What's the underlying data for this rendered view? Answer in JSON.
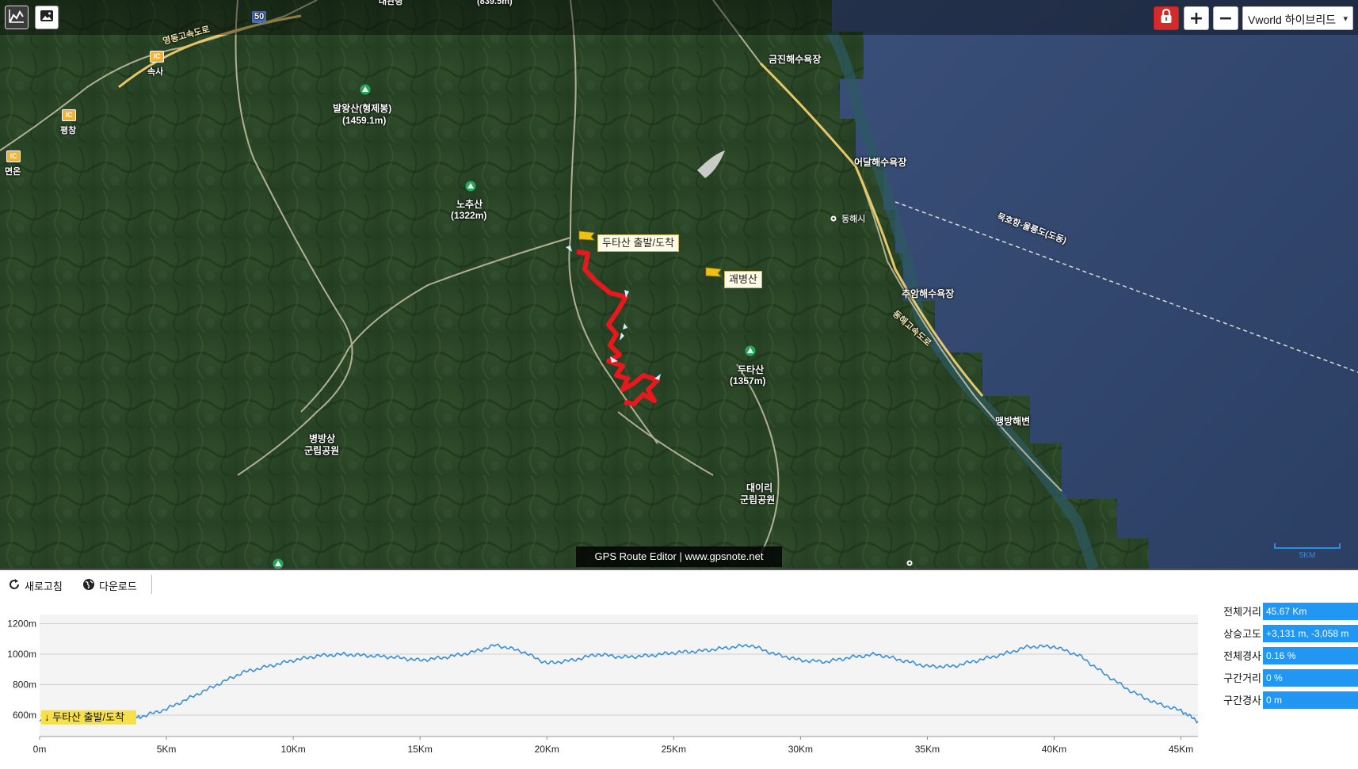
{
  "toolbar": {
    "chart_icon": "chart-icon",
    "image_icon": "image-icon",
    "lock_icon": "lock-icon",
    "zoom_in_label": "+",
    "zoom_out_label": "−",
    "layer_select": "Vworld 하이브리드"
  },
  "map": {
    "labels": {
      "top_place": "대관령",
      "top_peak": "(839.5m)",
      "sokssa": "속사",
      "pyeongchang": "평창",
      "myeonon": "면온",
      "balwangsan_name": "발왕산(형제봉)",
      "balwangsan_height": "(1459.1m)",
      "nochusan_name": "노추산",
      "nochusan_height": "(1322m)",
      "geumjin": "금진해수욕장",
      "eodal": "어달해수욕장",
      "donghae": "동해시",
      "chuam": "추암해수욕장",
      "dutasan_name": "두타산",
      "dutasan_height": "(1357m)",
      "maengbang": "맹방해변",
      "byeongbangsan_1": "병방상",
      "byeongbangsan_2": "군립공원",
      "daeiri_1": "대이리",
      "daeiri_2": "군립공원",
      "ferry": "묵호항-울릉도(도동)",
      "highway": "동해고속도로",
      "route50": "50",
      "ic": "IC",
      "yeongdong": "영동고속도로"
    },
    "flags": {
      "start": "두타산 출발/도착",
      "waypoint": "괘병산"
    },
    "credit": "GPS Route Editor | www.gpsnote.net",
    "scale_label": "5KM",
    "colors": {
      "route": "#e8181c",
      "sea": "#2a4060",
      "land": "#2c4a28"
    }
  },
  "bottom_toolbar": {
    "refresh_label": "새로고침",
    "download_label": "다운로드"
  },
  "chart_data": {
    "type": "area",
    "series": [
      {
        "x": [
          0,
          1,
          2,
          3,
          3.5,
          4,
          5,
          6,
          7,
          8,
          9,
          10,
          11,
          12,
          13,
          14,
          15,
          16,
          17,
          18,
          19,
          20,
          21,
          22,
          23,
          24,
          25,
          26,
          27,
          28,
          29,
          30,
          31,
          32,
          33,
          34,
          35,
          36,
          37,
          38,
          39,
          40,
          41,
          42,
          43,
          44,
          45,
          45.67
        ],
        "values": [
          560,
          555,
          565,
          570,
          575,
          590,
          640,
          720,
          800,
          880,
          920,
          960,
          990,
          1000,
          990,
          980,
          960,
          980,
          1010,
          1060,
          1020,
          940,
          960,
          1000,
          980,
          990,
          1010,
          1020,
          1040,
          1060,
          1000,
          960,
          950,
          980,
          1000,
          960,
          920,
          920,
          960,
          1000,
          1050,
          1050,
          990,
          870,
          760,
          680,
          630,
          560
        ]
      }
    ],
    "xlabel_ticks": [
      "0m",
      "5Km",
      "10Km",
      "15Km",
      "20Km",
      "25Km",
      "30Km",
      "35Km",
      "40Km",
      "45Km"
    ],
    "ylabel_ticks": [
      "600m",
      "800m",
      "1000m",
      "1200m"
    ],
    "xlim": [
      0,
      45.67
    ],
    "ylim": [
      460,
      1260
    ],
    "annotation": "↓ 두타산 출발/도착",
    "color": "#3a8fd9",
    "grid": true
  },
  "stats": [
    {
      "label": "전체거리",
      "value": "45.67 Km"
    },
    {
      "label": "상승고도",
      "value": "+3,131 m, -3,058 m"
    },
    {
      "label": "전체경사",
      "value": "0.16 %"
    },
    {
      "label": "구간거리",
      "value": "0 %"
    },
    {
      "label": "구간경사",
      "value": "0 m"
    }
  ]
}
